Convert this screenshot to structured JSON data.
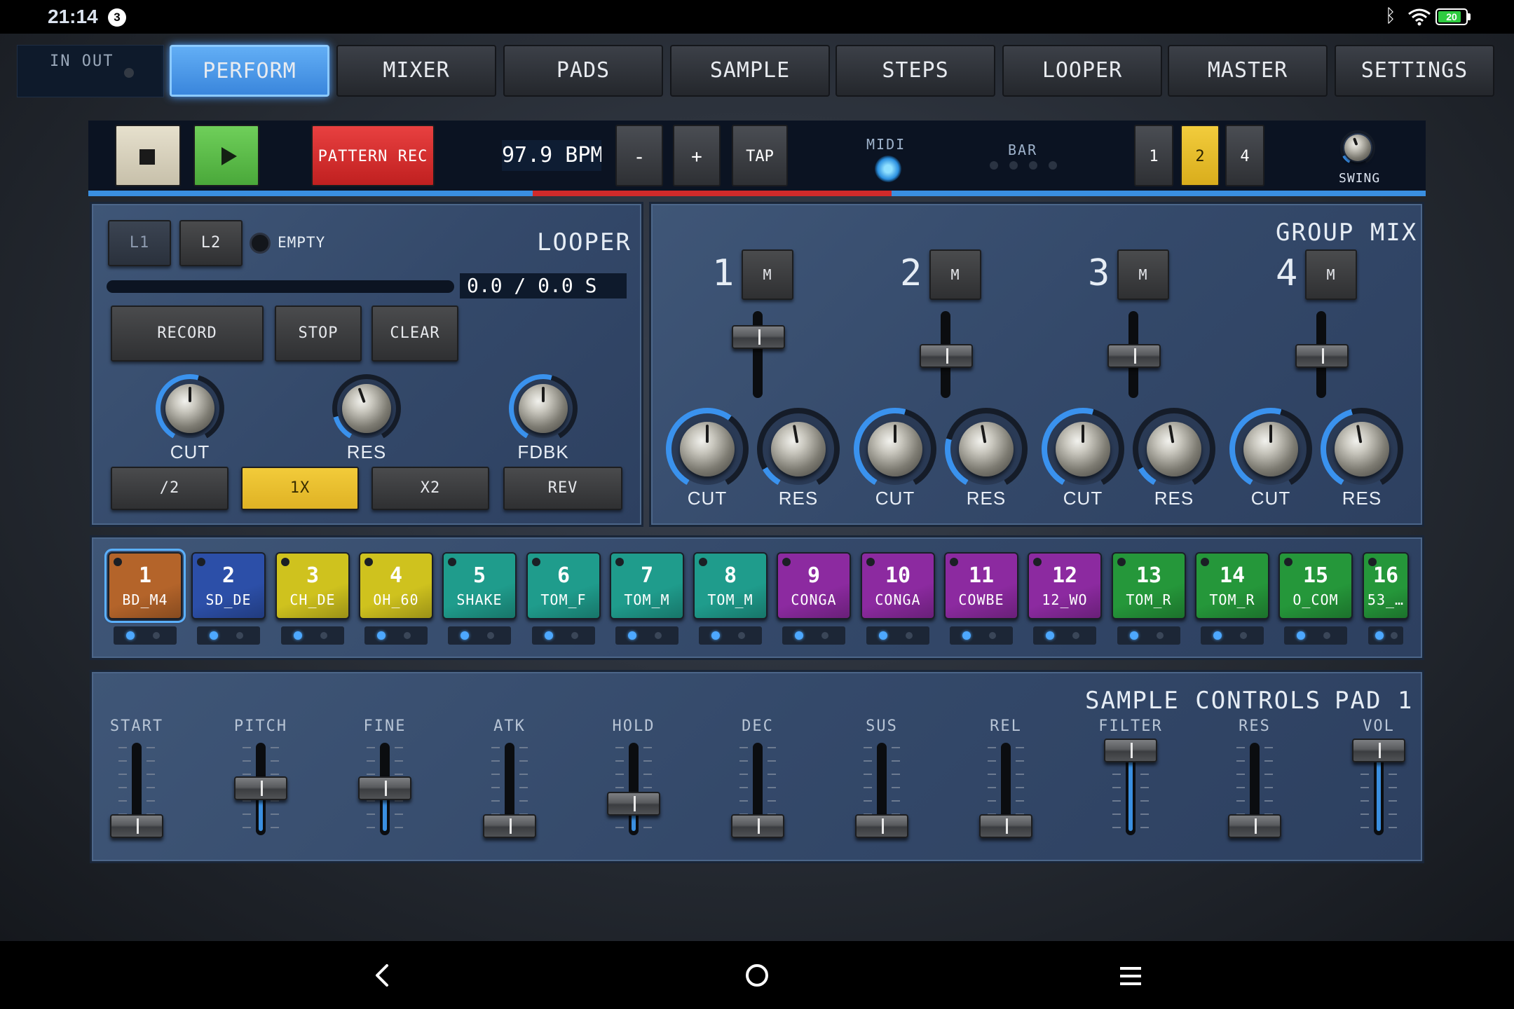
{
  "status_bar": {
    "time": "21:14",
    "notification_count": "3",
    "battery": "20"
  },
  "io": {
    "label": "IN OUT"
  },
  "tabs": [
    {
      "label": "PERFORM",
      "active": true
    },
    {
      "label": "MIXER"
    },
    {
      "label": "PADS"
    },
    {
      "label": "SAMPLE"
    },
    {
      "label": "STEPS"
    },
    {
      "label": "LOOPER"
    },
    {
      "label": "MASTER"
    },
    {
      "label": "SETTINGS"
    }
  ],
  "transport": {
    "pattern_rec": "PATTERN REC",
    "bpm": "97.9 BPM",
    "minus": "-",
    "plus": "+",
    "tap": "TAP",
    "midi": "MIDI",
    "bar": "BAR",
    "resolutions": [
      "1",
      "2",
      "4"
    ],
    "active_resolution": "2",
    "swing": "SWING"
  },
  "looper": {
    "title": "LOOPER",
    "l1": "L1",
    "l2": "L2",
    "state": "EMPTY",
    "time": "0.0 / 0.0 S",
    "record": "RECORD",
    "stop": "STOP",
    "clear": "CLEAR",
    "knobs": [
      "CUT",
      "RES",
      "FDBK"
    ],
    "speed": [
      "/2",
      "1X",
      "X2",
      "REV"
    ],
    "active_speed": "1X"
  },
  "group_mix": {
    "title": "GROUP MIX",
    "mute": "M",
    "groups": [
      {
        "number": "1",
        "fader_level": 0.8
      },
      {
        "number": "2",
        "fader_level": 0.5
      },
      {
        "number": "3",
        "fader_level": 0.5
      },
      {
        "number": "4",
        "fader_level": 0.5
      }
    ],
    "knob_labels": [
      "CUT",
      "RES"
    ]
  },
  "pads": [
    {
      "num": "1",
      "name": "BD_M4",
      "color": "#b4642a"
    },
    {
      "num": "2",
      "name": "SD_DE",
      "color": "#2c4fa8"
    },
    {
      "num": "3",
      "name": "CH_DE",
      "color": "#cfc21e"
    },
    {
      "num": "4",
      "name": "OH_60",
      "color": "#cfc21e"
    },
    {
      "num": "5",
      "name": "SHAKE",
      "color": "#1f9c8c"
    },
    {
      "num": "6",
      "name": "TOM_F",
      "color": "#1f9c8c"
    },
    {
      "num": "7",
      "name": "TOM_M",
      "color": "#1f9c8c"
    },
    {
      "num": "8",
      "name": "TOM_M",
      "color": "#1f9c8c"
    },
    {
      "num": "9",
      "name": "CONGA",
      "color": "#8c2aa0"
    },
    {
      "num": "10",
      "name": "CONGA",
      "color": "#8c2aa0"
    },
    {
      "num": "11",
      "name": "COWBE",
      "color": "#8c2aa0"
    },
    {
      "num": "12",
      "name": "12_WO",
      "color": "#8c2aa0"
    },
    {
      "num": "13",
      "name": "TOM_R",
      "color": "#25973a"
    },
    {
      "num": "14",
      "name": "TOM_R",
      "color": "#25973a"
    },
    {
      "num": "15",
      "name": "O_COM",
      "color": "#25973a"
    },
    {
      "num": "16",
      "name": "53_…",
      "color": "#25973a"
    }
  ],
  "sample_controls": {
    "title": "SAMPLE CONTROLS",
    "pad": "PAD 1",
    "sliders": [
      {
        "label": "START",
        "level": 0.0
      },
      {
        "label": "PITCH",
        "level": 0.5
      },
      {
        "label": "FINE",
        "level": 0.5
      },
      {
        "label": "ATK",
        "level": 0.0
      },
      {
        "label": "HOLD",
        "level": 0.3
      },
      {
        "label": "DEC",
        "level": 0.0
      },
      {
        "label": "SUS",
        "level": 0.0
      },
      {
        "label": "REL",
        "level": 0.0
      },
      {
        "label": "FILTER",
        "level": 1.0
      },
      {
        "label": "RES",
        "level": 0.0
      },
      {
        "label": "VOL",
        "level": 1.0
      }
    ]
  }
}
